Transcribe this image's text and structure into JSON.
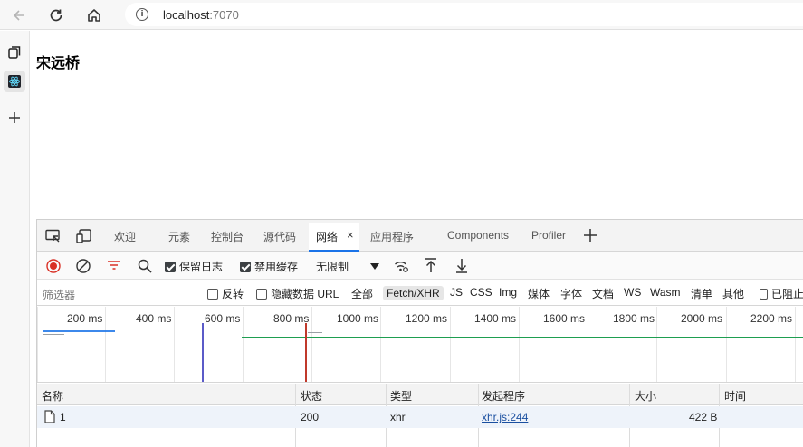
{
  "browser": {
    "url_host": "localhost",
    "url_port": ":7070"
  },
  "page": {
    "heading": "宋远桥"
  },
  "devtools": {
    "tabs": {
      "welcome": "欢迎",
      "elements": "元素",
      "console": "控制台",
      "sources": "源代码",
      "network": "网络",
      "application": "应用程序",
      "components": "Components",
      "profiler": "Profiler"
    },
    "toolbar": {
      "preserve_log": "保留日志",
      "disable_cache": "禁用缓存",
      "throttling": "无限制"
    },
    "filter": {
      "placeholder": "筛选器",
      "invert": "反转",
      "hide_data_urls": "隐藏数据 URL",
      "types": [
        "全部",
        "Fetch/XHR",
        "JS",
        "CSS",
        "Img",
        "媒体",
        "字体",
        "文档",
        "WS",
        "Wasm",
        "清单",
        "其他"
      ],
      "blocked": "已阻止"
    },
    "timeline_ticks": [
      "200 ms",
      "400 ms",
      "600 ms",
      "800 ms",
      "1000 ms",
      "1200 ms",
      "1400 ms",
      "1600 ms",
      "1800 ms",
      "2000 ms",
      "2200 ms"
    ],
    "table": {
      "headers": {
        "name": "名称",
        "status": "状态",
        "type": "类型",
        "initiator": "发起程序",
        "size": "大小",
        "time": "时间"
      },
      "rows": [
        {
          "name": "1",
          "status": "200",
          "type": "xhr",
          "initiator": "xhr.js:244",
          "size": "422 B"
        }
      ]
    }
  }
}
